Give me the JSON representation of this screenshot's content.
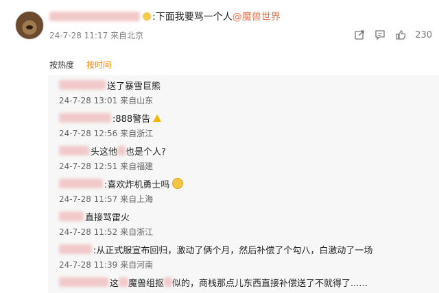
{
  "post": {
    "text_prefix": ":下面我要骂一个人",
    "mention": "@魔兽世界",
    "timestamp": "24-7-28 11:17",
    "location": "来自北京",
    "like_count": "230"
  },
  "sort": {
    "hot_label": "按热度",
    "time_label": "按时间"
  },
  "comments": [
    {
      "text": "送了暴雪巨熊",
      "timestamp": "24-7-28 13:01",
      "location": "来自山东"
    },
    {
      "text": ":888警告",
      "timestamp": "24-7-28 12:56",
      "location": "来自浙江"
    },
    {
      "text_a": "头",
      "text_b": "这他",
      "text_c": "也是个人?",
      "timestamp": "24-7-28 12:51",
      "location": "来自福建"
    },
    {
      "text": ":喜欢炸机勇士吗",
      "timestamp": "24-7-28 11:57",
      "location": "来自上海"
    },
    {
      "text": "直接骂雷火",
      "timestamp": "24-7-28 11:52",
      "location": "来自浙江"
    },
    {
      "text": ":从正式服宣布回归，激动了俩个月，然后补偿了个勾八，白激动了一场",
      "timestamp": "24-7-28 11:39",
      "location": "来自河南"
    },
    {
      "text_a": "这",
      "text_b": "魔兽组抠",
      "text_c": "似的，商栈那点儿东西直接补偿送了不就得了......"
    }
  ],
  "icons": [
    "share-icon",
    "comment-icon",
    "like-icon",
    "warning-icon",
    "smile-emoji-icon"
  ]
}
